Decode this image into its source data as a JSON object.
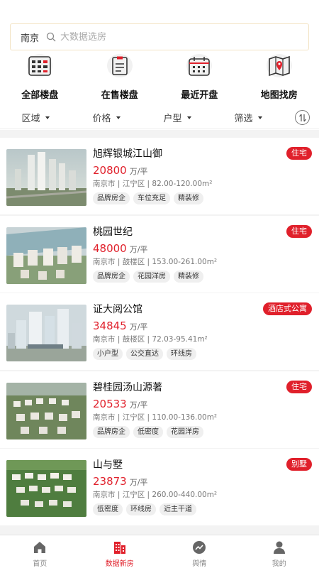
{
  "search": {
    "city": "南京",
    "placeholder": "大数据选房"
  },
  "categories": [
    {
      "label": "全部楼盘",
      "icon": "building-list-icon"
    },
    {
      "label": "在售楼盘",
      "icon": "document-icon"
    },
    {
      "label": "最近开盘",
      "icon": "calendar-icon"
    },
    {
      "label": "地图找房",
      "icon": "map-pin-icon"
    }
  ],
  "filters": [
    {
      "label": "区域"
    },
    {
      "label": "价格"
    },
    {
      "label": "户型"
    },
    {
      "label": "筛选"
    }
  ],
  "listings": [
    {
      "name": "旭辉银城江山御",
      "price": "20800",
      "unit": "万/平",
      "meta": "南京市 | 江宁区 | 82.00-120.00m²",
      "tags": [
        "品牌房企",
        "车位充足",
        "精装修"
      ],
      "badge": "住宅"
    },
    {
      "name": "桃园世纪",
      "price": "48000",
      "unit": "万/平",
      "meta": "南京市 | 鼓楼区 | 153.00-261.00m²",
      "tags": [
        "品牌房企",
        "花园洋房",
        "精装修"
      ],
      "badge": "住宅"
    },
    {
      "name": "证大阅公馆",
      "price": "34845",
      "unit": "万/平",
      "meta": "南京市 | 鼓楼区 | 72.03-95.41m²",
      "tags": [
        "小户型",
        "公交直达",
        "环线房"
      ],
      "badge": "酒店式公寓"
    },
    {
      "name": "碧桂园汤山源著",
      "price": "20533",
      "unit": "万/平",
      "meta": "南京市 | 江宁区 | 110.00-136.00m²",
      "tags": [
        "品牌房企",
        "低密度",
        "花园洋房"
      ],
      "badge": "住宅"
    },
    {
      "name": "山与墅",
      "price": "23873",
      "unit": "万/平",
      "meta": "南京市 | 江宁区 | 260.00-440.00m²",
      "tags": [
        "低密度",
        "环线房",
        "近主干道"
      ],
      "badge": "别墅"
    }
  ],
  "tabbar": [
    {
      "label": "首页",
      "icon": "home-icon"
    },
    {
      "label": "数据新房",
      "icon": "buildings-icon",
      "active": true
    },
    {
      "label": "舆情",
      "icon": "trend-icon"
    },
    {
      "label": "我的",
      "icon": "user-icon"
    }
  ],
  "colors": {
    "accent": "#e0202b",
    "tag_bg": "#efefef",
    "list_bg": "#f3f3f3"
  }
}
